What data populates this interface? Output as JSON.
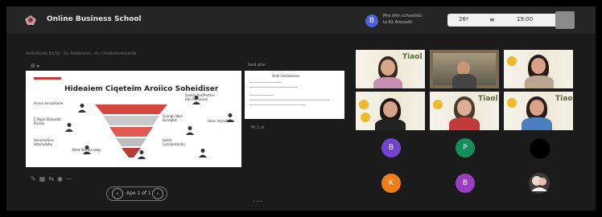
{
  "meeting": {
    "title": "Online Business School"
  },
  "presenter": {
    "avatar_initial": "B",
    "line1": "Piro ohin schoatidis",
    "line2": "to 61 Ahcusdic"
  },
  "controls": {
    "item1": "26*",
    "item2": "19:00"
  },
  "breadcrumbs": "Ambitbook Erctis  ·  Gs Ahbbiteim  ·  Ac Chidbodooteiatde",
  "slide": {
    "title": "Hideaiem Ciqeteim Aroiico Soheidiser",
    "bullets": [
      "Arroro Innubitadie",
      "C Bopo Stobadbt Paclito",
      "Aonomideve Hitomidaho",
      "Bmd Stordia rollg"
    ],
    "right_bullets": [
      "Sooelo ItecPesthoi Ado Stenbuoo",
      "Grangh Woo Gentgtet",
      "Hoan Inpnotinee",
      "Itoitle Cosodoiteriba"
    ],
    "page_number": "Ape 1 of 1"
  },
  "document": {
    "header": "Ileol ptor",
    "title": "Oebl Gndutemae",
    "page": "Ps 1 st"
  },
  "participants": [
    {
      "initial": "B",
      "color": "#6f45c9"
    },
    {
      "initial": "P",
      "color": "#148f5b"
    },
    {
      "initial": "",
      "color": "#000000"
    },
    {
      "initial": "K",
      "color": "#f07e1b"
    },
    {
      "initial": "B",
      "color": "#9a3fc2"
    }
  ],
  "brand_text": "Tiaol"
}
